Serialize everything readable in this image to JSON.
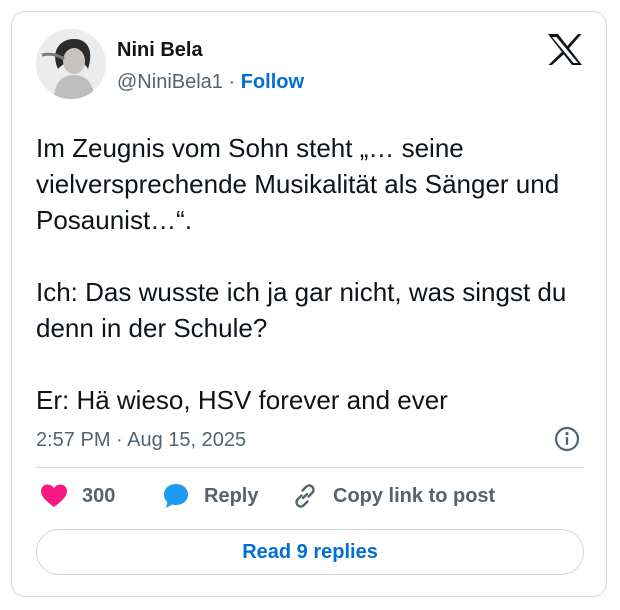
{
  "author": {
    "name": "Nini Bela",
    "handle": "@NiniBela1",
    "separator": "·",
    "follow_label": "Follow"
  },
  "tweet": {
    "text": "Im Zeugnis vom Sohn steht „… seine vielversprechende Musikalität als Sänger und Posaunist…“.\n\nIch: Das wusste ich ja gar nicht, was singst du denn in der Schule?\n\nEr: Hä wieso, HSV forever and ever",
    "timestamp": "2:57 PM · Aug 15, 2025"
  },
  "actions": {
    "like_count": "300",
    "reply_label": "Reply",
    "copy_label": "Copy link to post"
  },
  "read_replies_label": "Read 9 replies",
  "icons": {
    "logo": "x-logo-icon",
    "info": "info-icon",
    "like": "heart-icon",
    "reply": "speech-bubble-icon",
    "copy": "link-icon"
  },
  "colors": {
    "link_blue": "#006fd6",
    "like_pink": "#f91880",
    "reply_blue": "#1d9bf0",
    "muted_text": "#536471",
    "border": "#cfd9de"
  }
}
